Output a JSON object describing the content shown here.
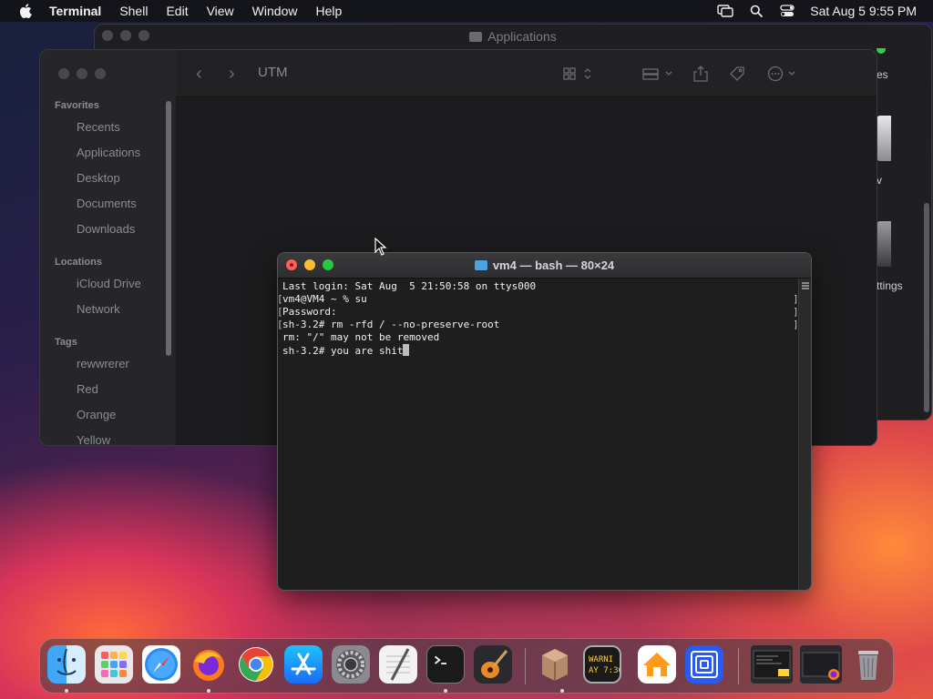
{
  "menubar": {
    "app_name": "Terminal",
    "items": [
      "Shell",
      "Edit",
      "View",
      "Window",
      "Help"
    ],
    "clock": "Sat Aug 5  9:55 PM"
  },
  "applications_window": {
    "title": "Applications",
    "edge_labels": [
      "es",
      "v",
      "ttings"
    ]
  },
  "finder": {
    "title": "UTM",
    "sidebar": {
      "favorites_header": "Favorites",
      "favorites": [
        "Recents",
        "Applications",
        "Desktop",
        "Documents",
        "Downloads"
      ],
      "locations_header": "Locations",
      "locations": [
        "iCloud Drive",
        "Network"
      ],
      "tags_header": "Tags",
      "tags": [
        "rewwrerer",
        "Red",
        "Orange",
        "Yellow"
      ]
    }
  },
  "terminal": {
    "title": "vm4 — bash — 80×24",
    "lines": [
      "Last login: Sat Aug  5 21:50:58 on ttys000",
      "vm4@VM4 ~ % su",
      "Password:",
      "sh-3.2# rm -rfd / --no-preserve-root",
      "rm: \"/\" may not be removed",
      "sh-3.2# you are shit"
    ]
  },
  "dock": {
    "apps": [
      "finder-icon",
      "launchpad-icon",
      "safari-icon",
      "firefox-icon",
      "chrome-icon",
      "app-store-icon",
      "system-settings-icon",
      "textedit-icon",
      "terminal-icon",
      "garageband-icon",
      "utm-icon",
      "console-icon",
      "home-icon",
      "screen-sharing-icon",
      "window-preview-terminal",
      "window-preview-firefox",
      "trash-icon"
    ],
    "console_text": "WARNI\nAY 7:36"
  }
}
